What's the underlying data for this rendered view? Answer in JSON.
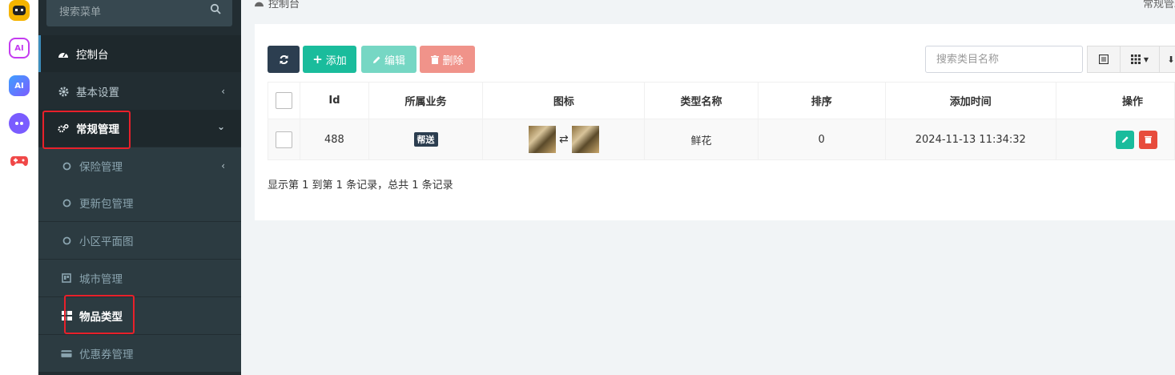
{
  "app_strip": {
    "icons": [
      "chat-bot-app-icon",
      "ai-app-icon",
      "ai-assistant-app-icon",
      "bot-app-icon",
      "game-app-icon"
    ],
    "labels": [
      "",
      "AI",
      "AI",
      "",
      ""
    ]
  },
  "sidebar": {
    "search_placeholder": "搜索菜单",
    "items": [
      {
        "label": "控制台"
      },
      {
        "label": "基本设置"
      },
      {
        "label": "常规管理"
      },
      {
        "label": "保险管理"
      },
      {
        "label": "更新包管理"
      },
      {
        "label": "小区平面图"
      },
      {
        "label": "城市管理"
      },
      {
        "label": "物品类型"
      },
      {
        "label": "优惠券管理"
      }
    ]
  },
  "breadcrumb": {
    "label": "控制台",
    "right": "常规管理"
  },
  "toolbar": {
    "add_label": "添加",
    "edit_label": "编辑",
    "delete_label": "删除",
    "search_placeholder": "搜索类目名称"
  },
  "table": {
    "headers": [
      "Id",
      "所属业务",
      "图标",
      "类型名称",
      "排序",
      "添加时间",
      "操作"
    ],
    "rows": [
      {
        "id": "488",
        "business": "帮送",
        "name": "鲜花",
        "sort": "0",
        "time": "2024-11-13 11:34:32"
      }
    ]
  },
  "pagination": {
    "info": "显示第 1 到第 1 条记录，总共 1 条记录"
  },
  "colors": {
    "accent": "#1abc9c",
    "sidebar": "#222d32",
    "highlight": "#e8202a"
  }
}
